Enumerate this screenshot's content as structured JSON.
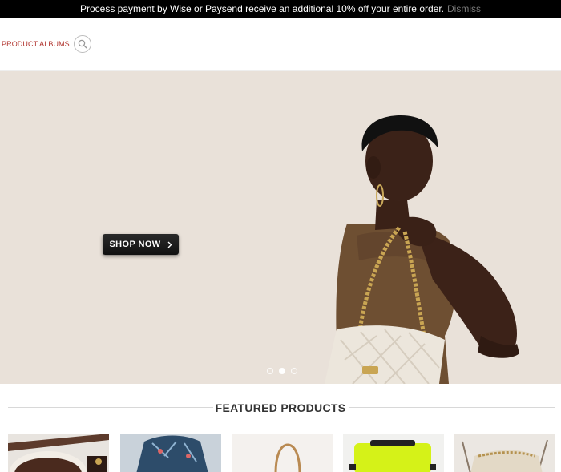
{
  "notice": {
    "text": "Process payment by Wise or Paysend receive an additional 10% off your entire order.",
    "dismiss": "Dismiss"
  },
  "header": {
    "nav_link": "PRODUCT ALBUMS",
    "search_icon": "search-icon"
  },
  "hero": {
    "button_label": "SHOP NOW",
    "button_icon": "chevron-right-icon",
    "slides_count": 3,
    "active_slide": 2,
    "background": "#e9e1d9"
  },
  "featured": {
    "title": "FEATURED PRODUCTS",
    "products": [
      {
        "name": "product-1"
      },
      {
        "name": "product-2"
      },
      {
        "name": "product-3"
      },
      {
        "name": "product-4"
      },
      {
        "name": "product-5"
      }
    ]
  }
}
